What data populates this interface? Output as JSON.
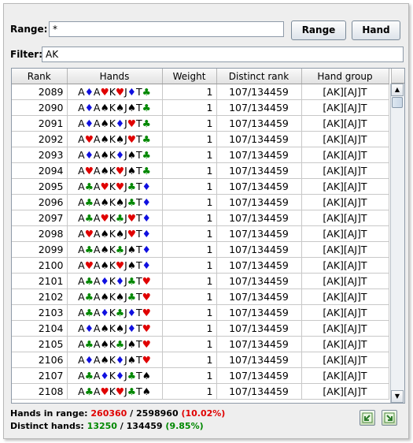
{
  "range": {
    "label": "Range:",
    "value": "*"
  },
  "filter": {
    "label": "Filter:",
    "value": "AK"
  },
  "buttons": {
    "range": "Range",
    "hand": "Hand"
  },
  "table": {
    "headers": [
      "Rank",
      "Hands",
      "Weight",
      "Distinct rank",
      "Hand group"
    ],
    "rows": [
      {
        "rank": "2089",
        "cards": [
          [
            "A",
            "♦"
          ],
          [
            "A",
            "♥"
          ],
          [
            "K",
            "♥"
          ],
          [
            "J",
            "♦"
          ],
          [
            "T",
            "♣"
          ]
        ],
        "weight": "1",
        "distinct": "107/134459",
        "group": "[AK][AJ]T"
      },
      {
        "rank": "2090",
        "cards": [
          [
            "A",
            "♦"
          ],
          [
            "A",
            "♠"
          ],
          [
            "K",
            "♠"
          ],
          [
            "J",
            "♠"
          ],
          [
            "T",
            "♣"
          ]
        ],
        "weight": "1",
        "distinct": "107/134459",
        "group": "[AK][AJ]T"
      },
      {
        "rank": "2091",
        "cards": [
          [
            "A",
            "♦"
          ],
          [
            "A",
            "♠"
          ],
          [
            "K",
            "♦"
          ],
          [
            "J",
            "♥"
          ],
          [
            "T",
            "♣"
          ]
        ],
        "weight": "1",
        "distinct": "107/134459",
        "group": "[AK][AJ]T"
      },
      {
        "rank": "2092",
        "cards": [
          [
            "A",
            "♥"
          ],
          [
            "A",
            "♠"
          ],
          [
            "K",
            "♠"
          ],
          [
            "J",
            "♥"
          ],
          [
            "T",
            "♣"
          ]
        ],
        "weight": "1",
        "distinct": "107/134459",
        "group": "[AK][AJ]T"
      },
      {
        "rank": "2093",
        "cards": [
          [
            "A",
            "♦"
          ],
          [
            "A",
            "♠"
          ],
          [
            "K",
            "♦"
          ],
          [
            "J",
            "♠"
          ],
          [
            "T",
            "♣"
          ]
        ],
        "weight": "1",
        "distinct": "107/134459",
        "group": "[AK][AJ]T"
      },
      {
        "rank": "2094",
        "cards": [
          [
            "A",
            "♥"
          ],
          [
            "A",
            "♠"
          ],
          [
            "K",
            "♥"
          ],
          [
            "J",
            "♠"
          ],
          [
            "T",
            "♣"
          ]
        ],
        "weight": "1",
        "distinct": "107/134459",
        "group": "[AK][AJ]T"
      },
      {
        "rank": "2095",
        "cards": [
          [
            "A",
            "♣"
          ],
          [
            "A",
            "♥"
          ],
          [
            "K",
            "♥"
          ],
          [
            "J",
            "♣"
          ],
          [
            "T",
            "♦"
          ]
        ],
        "weight": "1",
        "distinct": "107/134459",
        "group": "[AK][AJ]T"
      },
      {
        "rank": "2096",
        "cards": [
          [
            "A",
            "♣"
          ],
          [
            "A",
            "♠"
          ],
          [
            "K",
            "♠"
          ],
          [
            "J",
            "♣"
          ],
          [
            "T",
            "♦"
          ]
        ],
        "weight": "1",
        "distinct": "107/134459",
        "group": "[AK][AJ]T"
      },
      {
        "rank": "2097",
        "cards": [
          [
            "A",
            "♣"
          ],
          [
            "A",
            "♥"
          ],
          [
            "K",
            "♣"
          ],
          [
            "J",
            "♥"
          ],
          [
            "T",
            "♦"
          ]
        ],
        "weight": "1",
        "distinct": "107/134459",
        "group": "[AK][AJ]T"
      },
      {
        "rank": "2098",
        "cards": [
          [
            "A",
            "♥"
          ],
          [
            "A",
            "♠"
          ],
          [
            "K",
            "♠"
          ],
          [
            "J",
            "♥"
          ],
          [
            "T",
            "♦"
          ]
        ],
        "weight": "1",
        "distinct": "107/134459",
        "group": "[AK][AJ]T"
      },
      {
        "rank": "2099",
        "cards": [
          [
            "A",
            "♣"
          ],
          [
            "A",
            "♠"
          ],
          [
            "K",
            "♣"
          ],
          [
            "J",
            "♠"
          ],
          [
            "T",
            "♦"
          ]
        ],
        "weight": "1",
        "distinct": "107/134459",
        "group": "[AK][AJ]T"
      },
      {
        "rank": "2100",
        "cards": [
          [
            "A",
            "♥"
          ],
          [
            "A",
            "♠"
          ],
          [
            "K",
            "♥"
          ],
          [
            "J",
            "♠"
          ],
          [
            "T",
            "♦"
          ]
        ],
        "weight": "1",
        "distinct": "107/134459",
        "group": "[AK][AJ]T"
      },
      {
        "rank": "2101",
        "cards": [
          [
            "A",
            "♣"
          ],
          [
            "A",
            "♦"
          ],
          [
            "K",
            "♦"
          ],
          [
            "J",
            "♣"
          ],
          [
            "T",
            "♥"
          ]
        ],
        "weight": "1",
        "distinct": "107/134459",
        "group": "[AK][AJ]T"
      },
      {
        "rank": "2102",
        "cards": [
          [
            "A",
            "♣"
          ],
          [
            "A",
            "♠"
          ],
          [
            "K",
            "♠"
          ],
          [
            "J",
            "♣"
          ],
          [
            "T",
            "♥"
          ]
        ],
        "weight": "1",
        "distinct": "107/134459",
        "group": "[AK][AJ]T"
      },
      {
        "rank": "2103",
        "cards": [
          [
            "A",
            "♣"
          ],
          [
            "A",
            "♦"
          ],
          [
            "K",
            "♣"
          ],
          [
            "J",
            "♦"
          ],
          [
            "T",
            "♥"
          ]
        ],
        "weight": "1",
        "distinct": "107/134459",
        "group": "[AK][AJ]T"
      },
      {
        "rank": "2104",
        "cards": [
          [
            "A",
            "♦"
          ],
          [
            "A",
            "♠"
          ],
          [
            "K",
            "♠"
          ],
          [
            "J",
            "♦"
          ],
          [
            "T",
            "♥"
          ]
        ],
        "weight": "1",
        "distinct": "107/134459",
        "group": "[AK][AJ]T"
      },
      {
        "rank": "2105",
        "cards": [
          [
            "A",
            "♣"
          ],
          [
            "A",
            "♠"
          ],
          [
            "K",
            "♣"
          ],
          [
            "J",
            "♠"
          ],
          [
            "T",
            "♥"
          ]
        ],
        "weight": "1",
        "distinct": "107/134459",
        "group": "[AK][AJ]T"
      },
      {
        "rank": "2106",
        "cards": [
          [
            "A",
            "♦"
          ],
          [
            "A",
            "♠"
          ],
          [
            "K",
            "♦"
          ],
          [
            "J",
            "♠"
          ],
          [
            "T",
            "♥"
          ]
        ],
        "weight": "1",
        "distinct": "107/134459",
        "group": "[AK][AJ]T"
      },
      {
        "rank": "2107",
        "cards": [
          [
            "A",
            "♣"
          ],
          [
            "A",
            "♦"
          ],
          [
            "K",
            "♦"
          ],
          [
            "J",
            "♣"
          ],
          [
            "T",
            "♠"
          ]
        ],
        "weight": "1",
        "distinct": "107/134459",
        "group": "[AK][AJ]T"
      },
      {
        "rank": "2108",
        "cards": [
          [
            "A",
            "♣"
          ],
          [
            "A",
            "♥"
          ],
          [
            "K",
            "♥"
          ],
          [
            "J",
            "♣"
          ],
          [
            "T",
            "♠"
          ]
        ],
        "weight": "1",
        "distinct": "107/134459",
        "group": "[AK][AJ]T"
      }
    ]
  },
  "status": {
    "hands_label": "Hands in range:",
    "hands_count": "260360",
    "hands_sep": " / ",
    "hands_total": "2598960",
    "hands_pct": "(10.02%)",
    "distinct_label": "Distinct hands:",
    "distinct_count": "13250",
    "distinct_sep": " / ",
    "distinct_total": "134459",
    "distinct_pct": "(9.85%)"
  },
  "suit_colors": {
    "♥": "#e00000",
    "♦": "#1010e0",
    "♣": "#008800",
    "♠": "#000000"
  },
  "icons": {
    "export": "export-icon",
    "import": "import-icon"
  }
}
